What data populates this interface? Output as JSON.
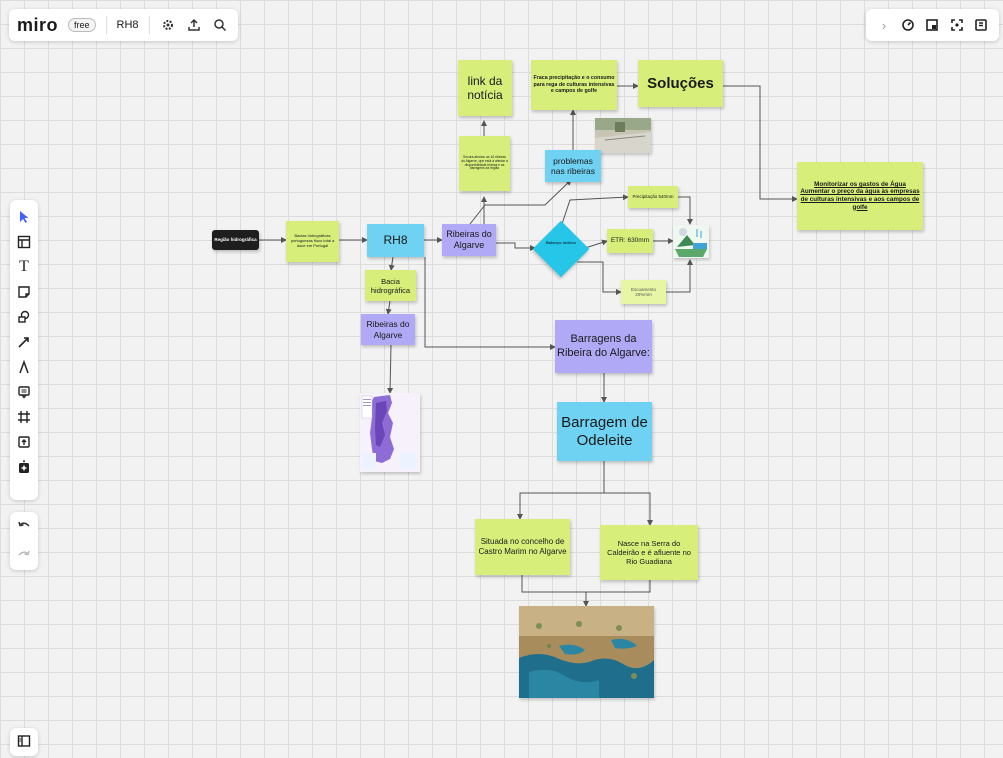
{
  "app": {
    "logo": "miro",
    "plan_badge": "free",
    "board_name": "RH8"
  },
  "topbar_icons": [
    "settings-icon",
    "share-upload-icon",
    "search-icon"
  ],
  "rightbar_icons": [
    "chevron-right-icon",
    "timer-icon",
    "card-icon",
    "focus-frame-icon",
    "reactions-icon"
  ],
  "toolbar_tools": [
    "select",
    "templates",
    "text",
    "sticky-note",
    "shapes",
    "connection-line",
    "pen",
    "comment",
    "frame",
    "upload",
    "more-apps"
  ],
  "nodes": {
    "regiao": "Região hidrográfica",
    "bacias": "Bacias hidrográficas portuguesas fluxo total a doce em Portugal",
    "rh8": "RH8",
    "ribeiras_algarve_top": "Ribeiras do Algarve",
    "bacia_hidrografica": "Bacia hidrográfica",
    "ribeiras_algarve_left": "Ribeiras do Algarve",
    "link_noticia": "link da notícia",
    "noticia_text": "Secura afectou as 16 ribeiras do Algarve, que está a afectar a disponibilidade hídrica e as barragens da região",
    "problemas": "problemas nas ribeiras",
    "fraca_precipitacao": "Fraca precipitação e o consumo para rega de culturas intensivas e campos de golfe",
    "solucoes": "Soluções",
    "monitorizar": "Monitorizar os gastos de Água Aumentar o preço da água às empresas de culturas intensivas e aos campos de golfe",
    "balanco_hidrico": "Balanço hídrico",
    "precipitacao": "Precipitação 540mm",
    "etr": "ETR: 630mm",
    "escoamento": "Escoamento 20%mm",
    "barragens_ribeira": "Barragens da Ribeira do Algarve:",
    "barragem_odeleite": "Barragem de Odeleite",
    "situada": "Situada no concelho de Castro Marim no Algarve",
    "nasce": "Nasce na Serra do Caldeirão e é afluente no Rio Guadiana"
  },
  "colors": {
    "accent": "#4262ff",
    "sticky_lime": "#d7ef7a",
    "shape_cyan": "#6fd2f2",
    "shape_violet": "#b0a9f5",
    "diamond": "#26c6e8"
  }
}
